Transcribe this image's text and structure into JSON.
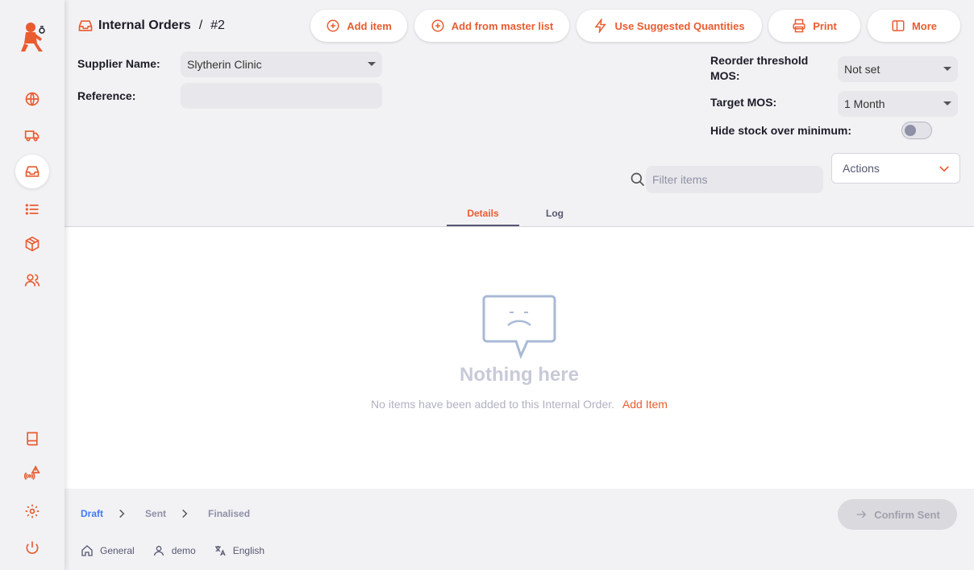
{
  "colors": {
    "accent": "#e95c30",
    "step_active": "#3e7bfa",
    "muted": "#8f90a6"
  },
  "sidebar": {
    "items": [
      {
        "icon": "globe-icon"
      },
      {
        "icon": "truck-icon"
      },
      {
        "icon": "inbox-icon",
        "active": true
      },
      {
        "icon": "list-icon"
      },
      {
        "icon": "package-icon"
      },
      {
        "icon": "users-icon"
      },
      {
        "icon": "book-icon"
      },
      {
        "icon": "sync-alert-icon"
      },
      {
        "icon": "gear-icon"
      },
      {
        "icon": "power-icon"
      }
    ]
  },
  "header": {
    "breadcrumb": {
      "section": "Internal Orders",
      "separator": "/",
      "number": "#2"
    },
    "toolbar": {
      "add_item": "Add item",
      "add_master": "Add from master list",
      "suggested": "Use Suggested Quantities",
      "print": "Print",
      "more": "More"
    },
    "supplier": {
      "label": "Supplier Name:",
      "value": "Slytherin Clinic"
    },
    "reference": {
      "label": "Reference:",
      "value": ""
    },
    "reorder": {
      "label_line1": "Reorder threshold",
      "label_line2": "MOS:",
      "value": "Not set"
    },
    "target": {
      "label": "Target MOS:",
      "value": "1 Month"
    },
    "hide_stock": {
      "label": "Hide stock over minimum:",
      "checked": false
    },
    "filter": {
      "placeholder": "Filter items"
    },
    "actions": {
      "label": "Actions"
    }
  },
  "tabs": [
    {
      "label": "Details",
      "active": true
    },
    {
      "label": "Log",
      "active": false
    }
  ],
  "empty": {
    "title": "Nothing here",
    "message": "No items have been added to this Internal Order.",
    "link": "Add Item"
  },
  "footer": {
    "steps": [
      {
        "label": "Draft",
        "current": true
      },
      {
        "label": "Sent",
        "current": false
      },
      {
        "label": "Finalised",
        "current": false
      }
    ],
    "confirm": "Confirm Sent",
    "store": "General",
    "user": "demo",
    "language": "English"
  }
}
